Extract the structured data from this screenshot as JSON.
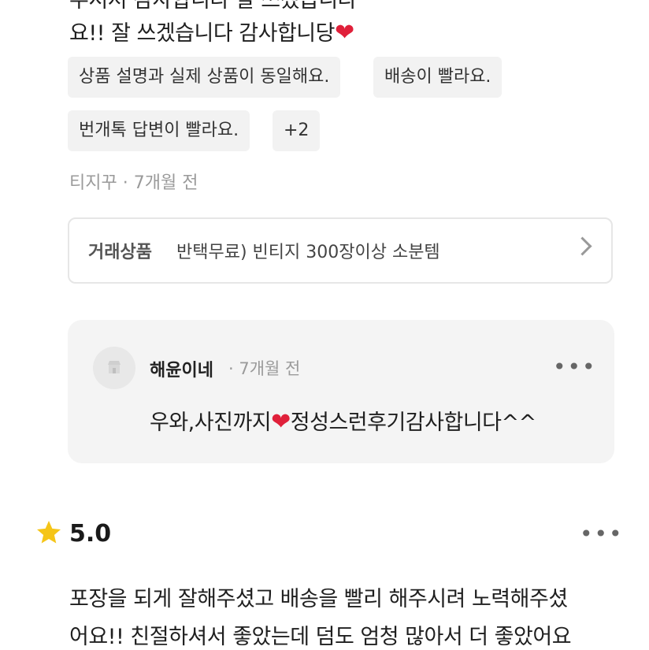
{
  "review1": {
    "text_top_fragment": "주셔서 감사합니다 잘 쓰겠습니다",
    "text_line2": "요!! 잘 쓰겠습니다 감사합니당",
    "tags": [
      "상품 설명과 실제 상품이 동일해요.",
      "배송이 빨라요.",
      "번개톡 답변이 빨라요.",
      "+2"
    ],
    "author": "티지꾸",
    "time": "7개월 전",
    "product_label": "거래상품",
    "product_name": "반택무료) 빈티지 300장이상 소분템"
  },
  "reply": {
    "name": "해윤이네",
    "time": "7개월 전",
    "text_before": "우와,사진까지",
    "text_after": "정성스런후기감사합니다^^"
  },
  "review2": {
    "rating": "5.0",
    "line1": "포장을 되게 잘해주셨고 배송을 빨리 해주시려 노력해주셨",
    "line2": "어요!! 친절하셔서 좋았는데 덤도 엄청 많아서 더 좋았어요"
  },
  "icons": {
    "heart": "heart-icon",
    "chevron": "chevron-right-icon",
    "more": "more-horizontal-icon",
    "store": "store-icon",
    "star": "star-icon"
  },
  "colors": {
    "heart": "#e0203a",
    "star": "#f5c518"
  }
}
